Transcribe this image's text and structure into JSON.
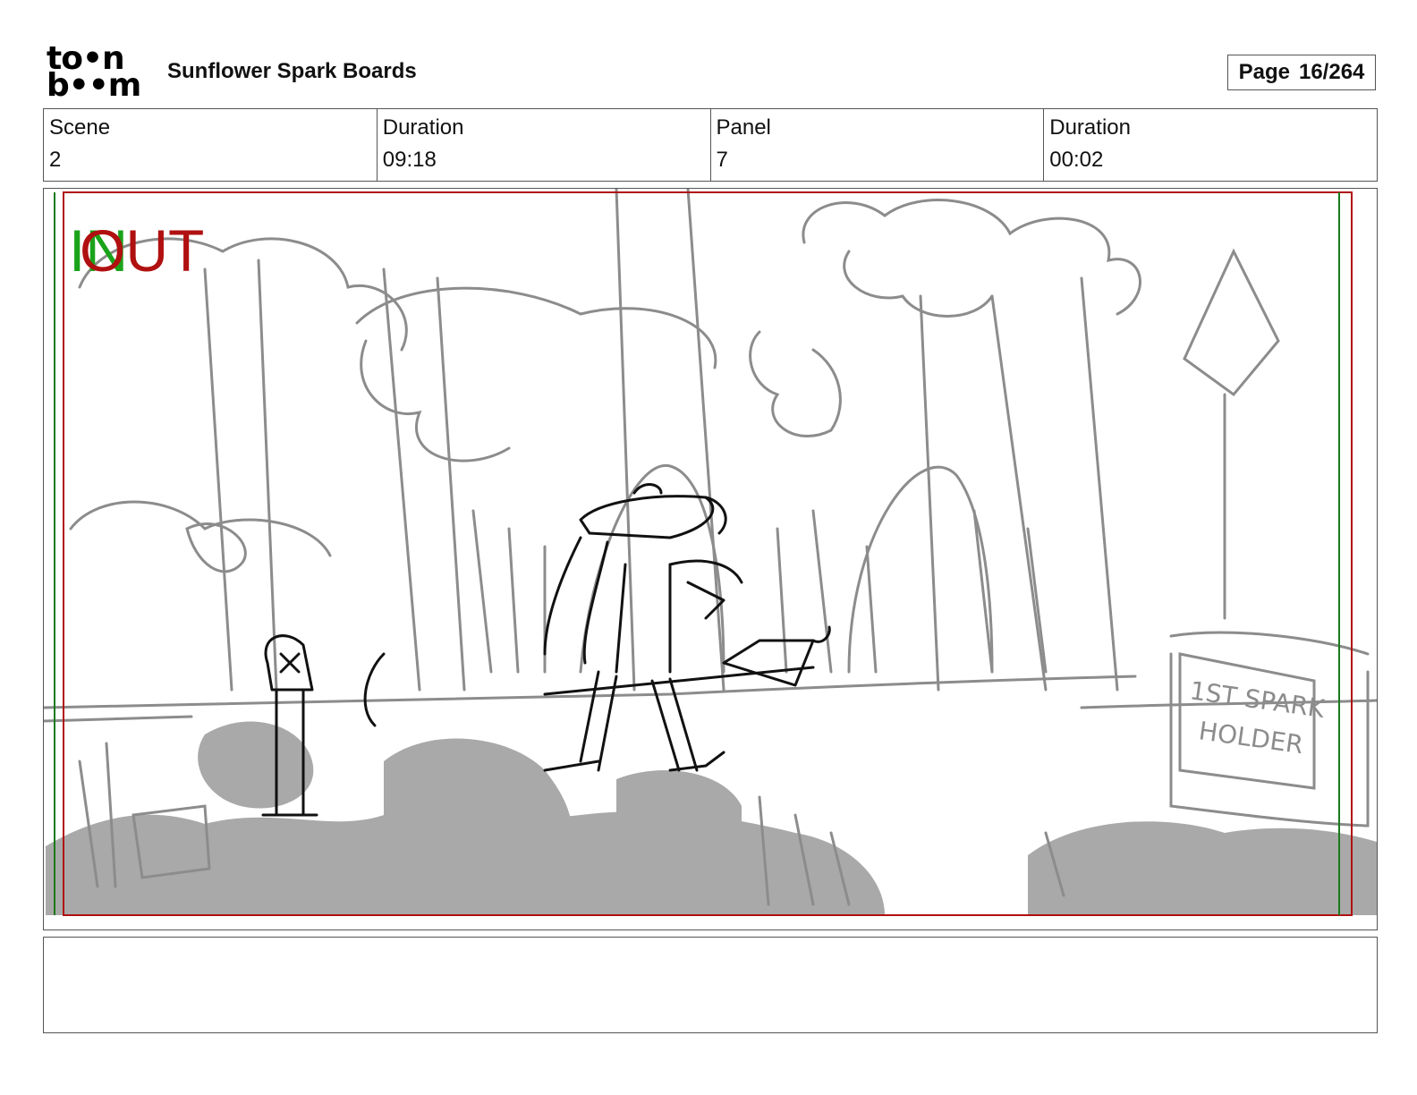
{
  "header": {
    "logo_line1": "to•n",
    "logo_line2": "b••m",
    "project_title": "Sunflower Spark Boards",
    "page_label": "Page",
    "page_value": "16/264"
  },
  "info": {
    "scene_label": "Scene",
    "scene_value": "2",
    "scene_duration_label": "Duration",
    "scene_duration_value": "09:18",
    "panel_label": "Panel",
    "panel_value": "7",
    "panel_duration_label": "Duration",
    "panel_duration_value": "00:02"
  },
  "panel": {
    "in_marker": "IN",
    "out_marker": "OUT",
    "sign_text_line1": "1ST SPARK",
    "sign_text_line2": "HOLDER",
    "colors": {
      "in_marker": "#1aa31a",
      "out_marker": "#b01010",
      "safe_frame_red": "#b01010",
      "safe_frame_green": "#1a7a1a",
      "background_sketch": "#8c8c8c",
      "character_sketch": "#111111",
      "shadow_fill": "#a9a9a9"
    }
  },
  "notes": {
    "text": ""
  }
}
